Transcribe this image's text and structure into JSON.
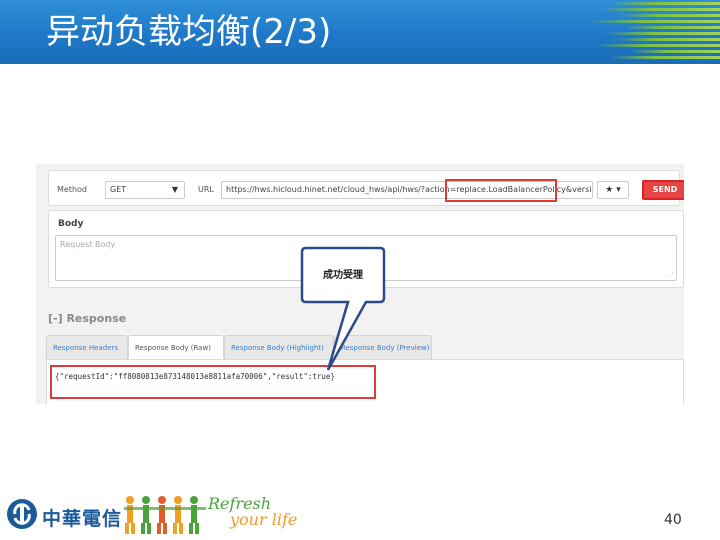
{
  "slide": {
    "title": "异动负载均衡(2/3)",
    "page_number": "40"
  },
  "request": {
    "method_label": "Method",
    "method_value": "GET",
    "url_label": "URL",
    "url_value": "https://hws.hicloud.hinet.net/cloud_hws/api/hws/?action=replace.LoadBalancerPolicy&version=",
    "favorite_icon": "star-icon",
    "send_label": "SEND"
  },
  "body": {
    "title": "Body",
    "placeholder": "Request Body"
  },
  "callout": {
    "text": "成功受理"
  },
  "response": {
    "title": "[-] Response",
    "tabs": [
      {
        "label": "Response Headers"
      },
      {
        "label": "Response Body (Raw)"
      },
      {
        "label": "Response Body (Highlight)"
      },
      {
        "label": "Response Body (Preview)"
      }
    ],
    "active_tab": 1,
    "raw_text": "{\"requestId\":\"ff8080813e873148013e8811afa70006\",\"result\":true}"
  },
  "footer": {
    "company": "中華電信",
    "slogan_line1": "Refresh",
    "slogan_line2": "your life"
  },
  "colors": {
    "title_bar": "#1f78c8",
    "highlight_box": "#e03a3a",
    "send_button": "#e64545",
    "callout_border": "#2a4a8a",
    "tab_text": "#3a7fc8"
  }
}
